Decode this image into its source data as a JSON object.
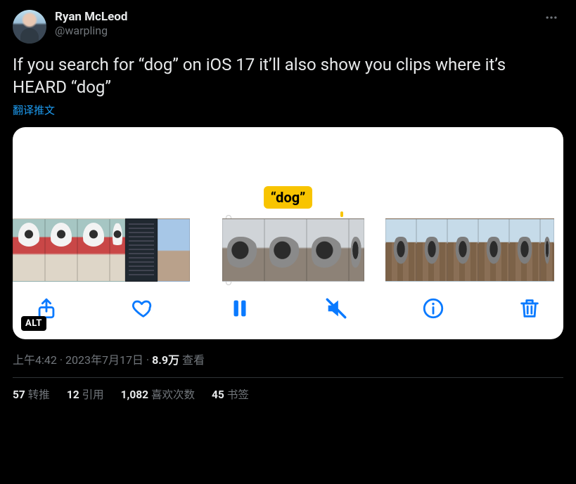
{
  "author": {
    "display_name": "Ryan McLeod",
    "handle": "@warpling"
  },
  "tweet_text": "If you search for “dog” on iOS 17 it’ll also show you clips where it’s HEARD “dog”",
  "translate_label": "翻译推文",
  "media": {
    "caption_bubble": "“dog”",
    "alt_badge": "ALT",
    "toolbar_icons": [
      "share",
      "heart",
      "pause",
      "mute",
      "info",
      "trash"
    ]
  },
  "meta": {
    "time": "上午4:42",
    "date": "2023年7月17日",
    "views_number": "8.9万",
    "views_label": "查看"
  },
  "stats": {
    "retweets": {
      "count": "57",
      "label": "转推"
    },
    "quotes": {
      "count": "12",
      "label": "引用"
    },
    "likes": {
      "count": "1,082",
      "label": "喜欢次数"
    },
    "bookmarks": {
      "count": "45",
      "label": "书签"
    }
  }
}
